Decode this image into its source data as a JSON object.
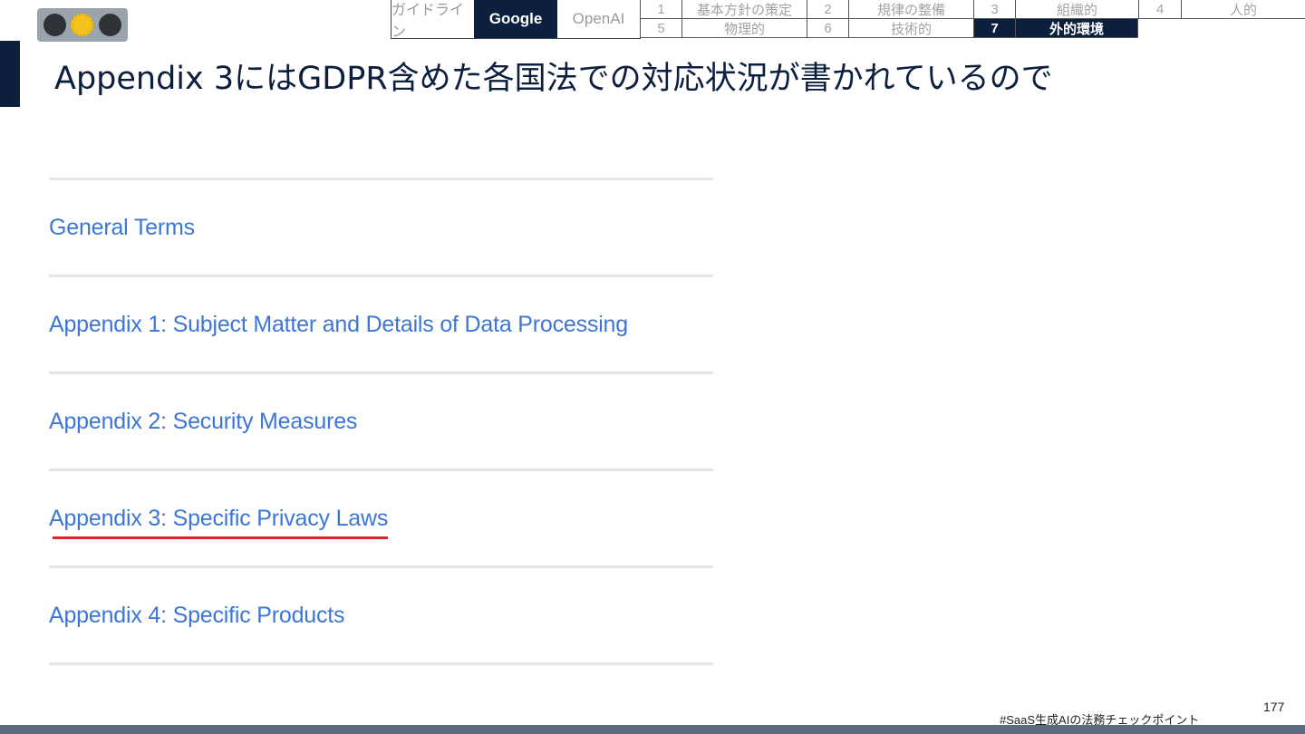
{
  "tabs": [
    "ガイドライン",
    "Google",
    "OpenAI"
  ],
  "steps": [
    {
      "num": "1",
      "label": "基本方針の策定"
    },
    {
      "num": "2",
      "label": "規律の整備"
    },
    {
      "num": "3",
      "label": "組織的"
    },
    {
      "num": "4",
      "label": "人的"
    },
    {
      "num": "5",
      "label": "物理的"
    },
    {
      "num": "6",
      "label": "技術的"
    },
    {
      "num": "7",
      "label": "外的環境"
    }
  ],
  "title": "Appendix 3にはGDPR含めた各国法での対応状況が書かれているので",
  "sections": [
    "General Terms",
    "Appendix 1: Subject Matter and Details of Data Processing",
    "Appendix 2: Security Measures",
    "Appendix 3: Specific Privacy Laws",
    "Appendix 4: Specific Products"
  ],
  "footer": {
    "hashtag": "#SaaS生成AIの法務チェックポイント",
    "page": "177"
  },
  "colors": {
    "navy": "#0c1f3f",
    "link": "#3c76d6",
    "highlight": "#d8282a"
  }
}
